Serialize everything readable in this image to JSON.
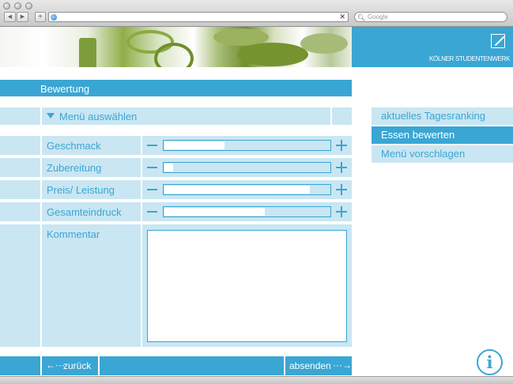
{
  "browser": {
    "url": "",
    "search_placeholder": "Google",
    "back_icon": "arrow-left-icon",
    "forward_icon": "arrow-right-icon",
    "add_icon": "plus-icon"
  },
  "brand": {
    "name": "KÖLNER STUDENTENWERK"
  },
  "section": {
    "title": "Bewertung"
  },
  "menu_select": {
    "label": "Menü auswählen"
  },
  "ratings": [
    {
      "label": "Geschmack",
      "value": 0.37
    },
    {
      "label": "Zubereitung",
      "value": 0.06
    },
    {
      "label": "Preis/ Leistung",
      "value": 0.88
    },
    {
      "label": "Gesamteindruck",
      "value": 0.61
    }
  ],
  "comment": {
    "label": "Kommentar",
    "value": ""
  },
  "buttons": {
    "back": "zurück",
    "submit": "absenden"
  },
  "side_nav": [
    {
      "label": "aktuelles Tagesranking",
      "active": false
    },
    {
      "label": "Essen bewerten",
      "active": true
    },
    {
      "label": "Menü vorschlagen",
      "active": false
    }
  ],
  "colors": {
    "accent": "#3aa6d4",
    "light": "#c9e6f2"
  }
}
